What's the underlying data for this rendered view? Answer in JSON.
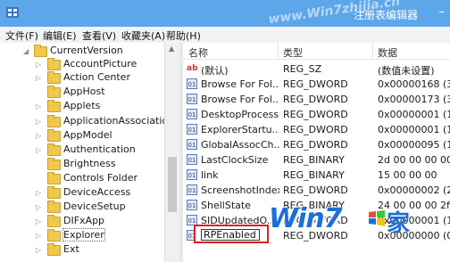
{
  "window": {
    "title": "注册表编辑器",
    "watermark_top": "www.Win7zhijia.cn"
  },
  "menu": [
    "文件(F)",
    "编辑(E)",
    "查看(V)",
    "收藏夹(A)",
    "帮助(H)"
  ],
  "tree": {
    "root": "CurrentVersion",
    "items": [
      "AccountPicture",
      "Action Center",
      "AppHost",
      "Applets",
      "ApplicationAssociatio",
      "AppModel",
      "Authentication",
      "Brightness",
      "Controls Folder",
      "DeviceAccess",
      "DeviceSetup",
      "DIFxApp",
      "Explorer",
      "Ext"
    ]
  },
  "list": {
    "columns": {
      "name": "名称",
      "type": "类型",
      "data": "数据"
    },
    "rows": [
      {
        "icon": "ab",
        "name": "(默认)",
        "type": "REG_SZ",
        "data": "(数值未设置)"
      },
      {
        "icon": "bin",
        "name": "Browse For Fol...",
        "type": "REG_DWORD",
        "data": "0x00000168 (36"
      },
      {
        "icon": "bin",
        "name": "Browse For Fol...",
        "type": "REG_DWORD",
        "data": "0x00000173 (37"
      },
      {
        "icon": "bin",
        "name": "DesktopProcess",
        "type": "REG_DWORD",
        "data": "0x00000001 (1)"
      },
      {
        "icon": "bin",
        "name": "ExplorerStartu...",
        "type": "REG_DWORD",
        "data": "0x00000001 (1)"
      },
      {
        "icon": "bin",
        "name": "GlobalAssocCh...",
        "type": "REG_DWORD",
        "data": "0x00000095 (14"
      },
      {
        "icon": "bin",
        "name": "LastClockSize",
        "type": "REG_BINARY",
        "data": "2d 00 00 00 00 0"
      },
      {
        "icon": "bin",
        "name": "link",
        "type": "REG_BINARY",
        "data": "15 00 00 00"
      },
      {
        "icon": "bin",
        "name": "ScreenshotIndex",
        "type": "REG_DWORD",
        "data": "0x00000002 (2)"
      },
      {
        "icon": "bin",
        "name": "ShellState",
        "type": "REG_BINARY",
        "data": "24 00 00 00 2f a"
      },
      {
        "icon": "bin",
        "name": "SIDUpdatedO...",
        "type": "REG_DWORD",
        "data": "0x00000001 (1)"
      },
      {
        "icon": "bin",
        "name": "",
        "type": "REG_DWORD",
        "data": "0x00000000 (0)"
      }
    ],
    "rename_value": "RPEnabled"
  },
  "watermark": {
    "logo": "Win7",
    "logo_suffix": "家",
    "url": "www.Win7zhijia.cn"
  }
}
